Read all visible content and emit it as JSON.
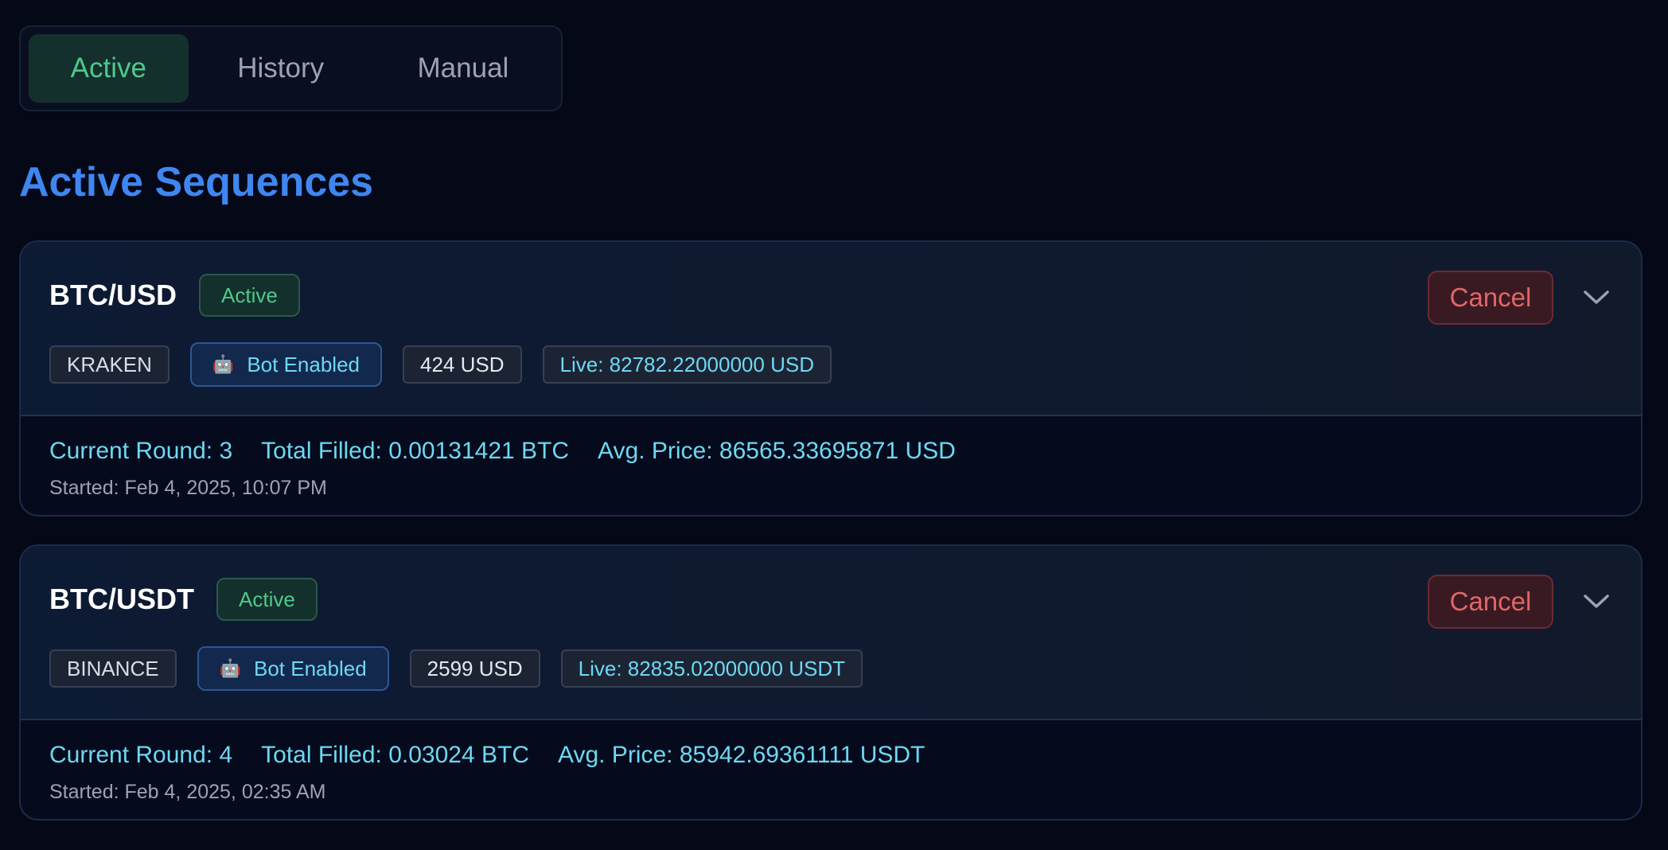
{
  "tabs": [
    {
      "label": "Active",
      "active": true
    },
    {
      "label": "History",
      "active": false
    },
    {
      "label": "Manual",
      "active": false
    }
  ],
  "section_title": "Active Sequences",
  "sequences": [
    {
      "pair": "BTC/USD",
      "status": "Active",
      "cancel_label": "Cancel",
      "exchange": "KRAKEN",
      "bot_label": "Bot Enabled",
      "amount": "424 USD",
      "live": "Live: 82782.22000000 USD",
      "current_round": "Current Round: 3",
      "total_filled": "Total Filled: 0.00131421 BTC",
      "avg_price": "Avg. Price: 86565.33695871 USD",
      "started": "Started: Feb 4, 2025, 10:07 PM"
    },
    {
      "pair": "BTC/USDT",
      "status": "Active",
      "cancel_label": "Cancel",
      "exchange": "BINANCE",
      "bot_label": "Bot Enabled",
      "amount": "2599 USD",
      "live": "Live: 82835.02000000 USDT",
      "current_round": "Current Round: 4",
      "total_filled": "Total Filled: 0.03024 BTC",
      "avg_price": "Avg. Price: 85942.69361111 USDT",
      "started": "Started: Feb 4, 2025, 02:35 AM"
    }
  ],
  "colors": {
    "background": "#040817",
    "accent_blue": "#3f86f0",
    "active_green": "#4fc98a",
    "cancel_red": "#e06666",
    "cyan_text": "#6ed8f2"
  },
  "icons": {
    "bot": "robot-icon",
    "expand": "chevron-down-icon"
  }
}
